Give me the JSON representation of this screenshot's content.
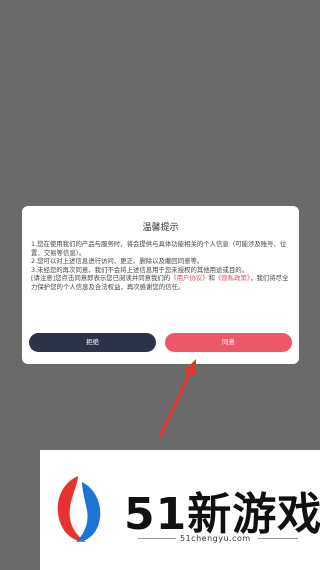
{
  "dialog": {
    "title": "温馨提示",
    "line1": "1.您在使用我们的产品与服务时，将会提供与具体功能相关的个人信息（可能涉及账号、位置、交易等信息）。",
    "line2": "2.您可以对上述信息进行访问、更正、删除以及撤回同意等。",
    "line3": "3.未经您的再次同意，我们不会将上述信息用于您未授权的其他用途或目的。",
    "notice_prefix": "[请注意]您点击同意即表示您已阅读并同意我们的",
    "user_agreement": "《用户协议》",
    "and": "和",
    "privacy_policy": "《隐私政策》",
    "notice_suffix": "，我们将尽全力保护您的个人信息及合法权益，再次感谢您的信任。",
    "reject_label": "拒绝",
    "agree_label": "同意"
  },
  "banner": {
    "brand_number": "51",
    "brand_text": "新游戏",
    "url": "51chengyu.com"
  },
  "colors": {
    "overlay": "#6a6a6a",
    "reject_button": "#2d3449",
    "agree_button": "#ee5766",
    "link": "#d9506a",
    "arrow": "#e8322f"
  },
  "icons": {
    "arrow": "red-pointer-arrow-icon",
    "logo": "51-logo-icon"
  }
}
